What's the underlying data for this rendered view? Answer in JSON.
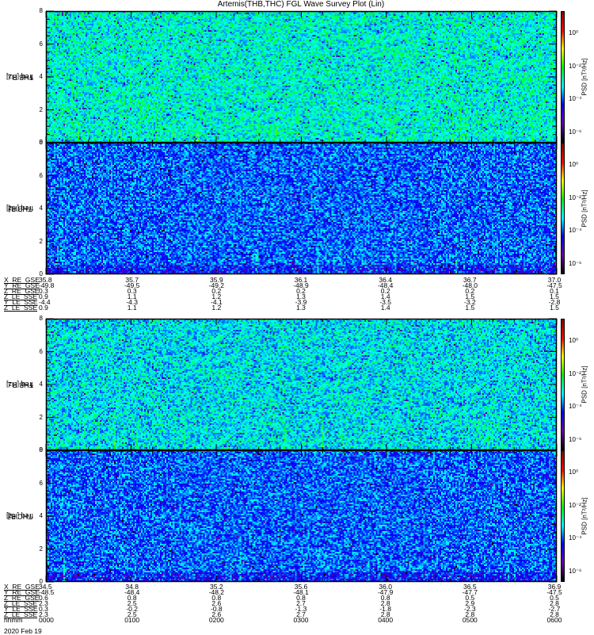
{
  "chart_data": {
    "type": "heatmap",
    "title": "Artemis(THB,THC) FGL Wave Survey Plot (Lin)",
    "panels": [
      {
        "label": "THB B⊥",
        "ylabel": "freq [Hz]",
        "ylim": [
          0,
          8
        ],
        "yticks": [
          "0",
          "2",
          "4",
          "6",
          "8"
        ],
        "zlabel": "PSD [nT²/Hz]",
        "zlim_log10": [
          -6.6,
          1.4
        ],
        "typical_log10_psd": -3.0,
        "low_freq_enhancement": true
      },
      {
        "label": "THB B∥",
        "ylabel": "freq [Hz]",
        "ylim": [
          0,
          8
        ],
        "yticks": [
          "0",
          "2",
          "4",
          "6",
          "8"
        ],
        "zlabel": "PSD [nT²/Hz]",
        "zlim_log10": [
          -6.6,
          1.4
        ],
        "typical_log10_psd": -3.9,
        "low_freq_enhancement": false
      },
      {
        "label": "THB B⊥",
        "ylabel": "freq [Hz]",
        "ylim": [
          0,
          8
        ],
        "yticks": [
          "0",
          "2",
          "4",
          "6",
          "8"
        ],
        "zlabel": "PSD [nT²/Hz]",
        "zlim_log10": [
          -6.6,
          1.4
        ],
        "typical_log10_psd": -3.2,
        "low_freq_enhancement": true
      },
      {
        "label": "THC B∥",
        "ylabel": "freq [Hz]",
        "ylim": [
          0,
          8
        ],
        "yticks": [
          "0",
          "2",
          "4",
          "6",
          "8"
        ],
        "zlabel": "PSD [nT²/Hz]",
        "zlim_log10": [
          -6.6,
          1.4
        ],
        "typical_log10_psd": -3.9,
        "low_freq_enhancement": false
      }
    ],
    "colorbar_ticks": [
      "10⁰",
      "10⁻²",
      "10⁻⁴",
      "10⁻⁶"
    ],
    "colorbar_tick_values_log10": [
      0,
      -2,
      -4,
      -6
    ],
    "xlim_hhmm": [
      "0000",
      "0600"
    ],
    "colormap": [
      "#000000",
      "#6a00a8",
      "#0000ff",
      "#00ffff",
      "#00ff00",
      "#ffff00",
      "#ff0000",
      "#800000"
    ]
  },
  "ephemeris_thb": {
    "labels": [
      "X_RE_GSE",
      "Y_RE_GSE",
      "Z_RE_GSE",
      "Z_LE_SSE",
      "Y_LE_SSE",
      "Z_LE_SSE"
    ],
    "rows": [
      [
        "35.8",
        "35.7",
        "35.9",
        "36.1",
        "36.4",
        "36.7",
        "37.0"
      ],
      [
        "-49.8",
        "-49.5",
        "-49.2",
        "-48.9",
        "-48.4",
        "-48.0",
        "-47.5"
      ],
      [
        "0.3",
        "0.3",
        "0.2",
        "0.2",
        "0.2",
        "0.2",
        "0.1"
      ],
      [
        "0.9",
        "1.1",
        "1.2",
        "1.3",
        "1.4",
        "1.5",
        "1.5"
      ],
      [
        "-4.4",
        "-4.3",
        "-4.1",
        "-3.9",
        "-3.5",
        "-3.2",
        "-2.8"
      ],
      [
        "0.9",
        "1.1",
        "1.2",
        "1.3",
        "1.4",
        "1.5",
        "1.5"
      ]
    ]
  },
  "ephemeris_thc": {
    "labels": [
      "X_RE_GSE",
      "Y_RE_GSE",
      "Z_RE_GSE",
      "Z_LE_SSE",
      "Y_LE_SSE",
      "Z_LE_SSE",
      "hhmm"
    ],
    "rows": [
      [
        "34.5",
        "34.8",
        "35.2",
        "35.6",
        "36.0",
        "36.5",
        "36.9"
      ],
      [
        "-48.5",
        "-48.4",
        "-48.2",
        "-48.1",
        "-47.9",
        "-47.7",
        "-47.5"
      ],
      [
        "0.6",
        "0.8",
        "0.8",
        "0.8",
        "0.8",
        "0.5",
        "0.5"
      ],
      [
        "2.3",
        "2.5",
        "2.6",
        "2.7",
        "2.8",
        "2.9",
        "2.8"
      ],
      [
        "0.3",
        "-0.2",
        "-0.8",
        "-1.3",
        "-1.8",
        "-2.3",
        "-2.7"
      ],
      [
        "2.3",
        "2.5",
        "2.6",
        "2.7",
        "2.8",
        "2.8",
        "2.8"
      ],
      [
        "0000",
        "0100",
        "0200",
        "0300",
        "0400",
        "0500",
        "0600"
      ]
    ],
    "date": "2020 Feb 19"
  }
}
